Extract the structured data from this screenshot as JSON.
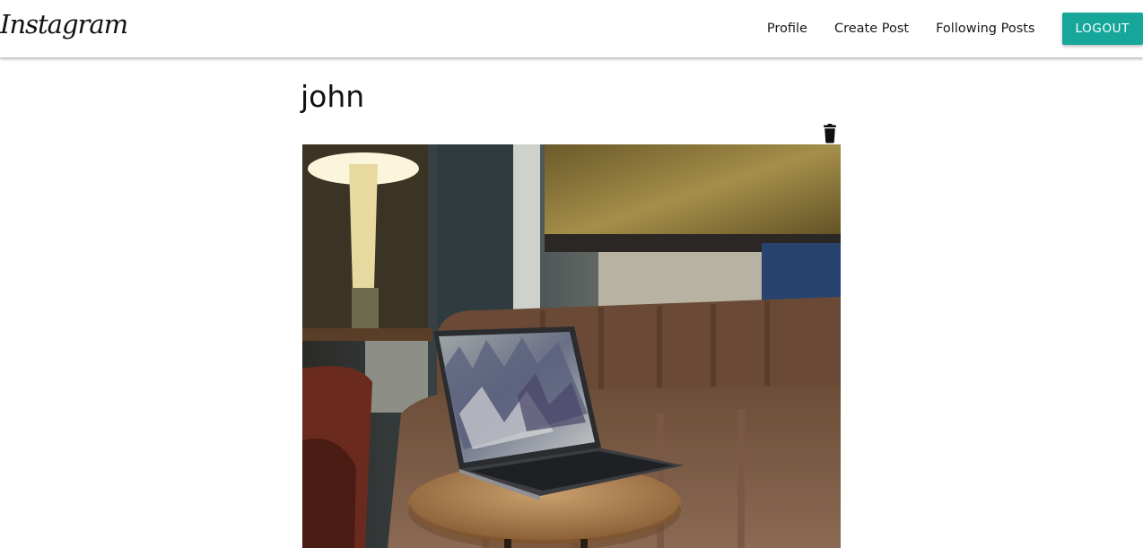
{
  "navbar": {
    "brand": "Instagram",
    "links": {
      "profile": "Profile",
      "create_post": "Create Post",
      "following_posts": "Following Posts"
    },
    "logout_label": "LOGOUT",
    "logout_color": "#16a79a"
  },
  "post": {
    "username": "john",
    "delete_icon": "trash-icon",
    "image": {
      "depicts": "laptop-on-table-photo"
    }
  }
}
